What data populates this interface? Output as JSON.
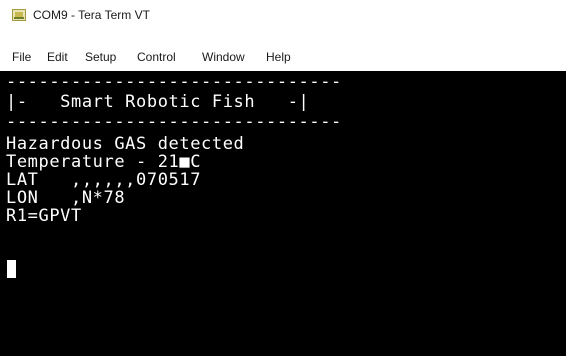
{
  "window": {
    "title": "COM9 - Tera Term VT",
    "icon": "teraterm-app-icon"
  },
  "menubar": {
    "items": [
      "File",
      "Edit",
      "Setup",
      "Control",
      "Window",
      "Help"
    ]
  },
  "terminal": {
    "lines": [
      "-------------------------------",
      "|-   Smart Robotic Fish   -|",
      "-------------------------------",
      "Hazardous GAS detected",
      "Temperature - 21■C",
      "LAT   ,,,,,,070517",
      "LON   ,N*78",
      "R1=GPVT"
    ],
    "cursor": "block-cursor"
  }
}
